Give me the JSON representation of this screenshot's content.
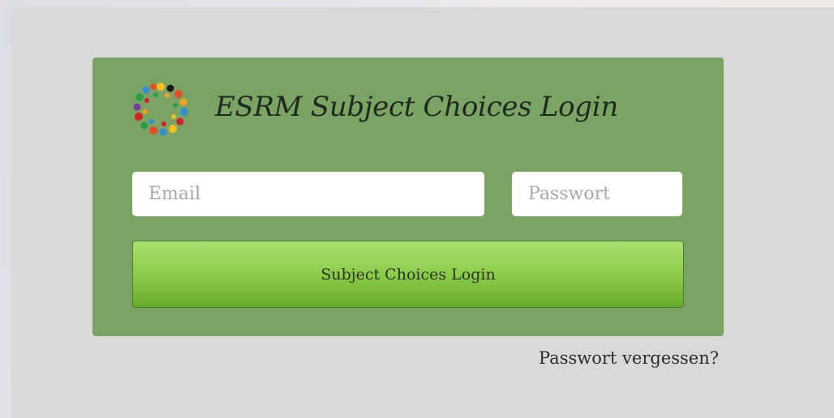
{
  "login": {
    "title": "ESRM Subject Choices Login",
    "email_placeholder": "Email",
    "password_placeholder": "Passwort",
    "submit_label": "Subject Choices Login",
    "forgot_label": "Passwort vergessen?",
    "logo_icon": "colorful-people-circle-logo-icon"
  },
  "colors": {
    "page_background": "#d9d9d9",
    "panel_background": "#7ba364",
    "button_gradient_top": "#a9e071",
    "button_gradient_bottom": "#69ab2a",
    "title_text": "#1f2a1f"
  }
}
